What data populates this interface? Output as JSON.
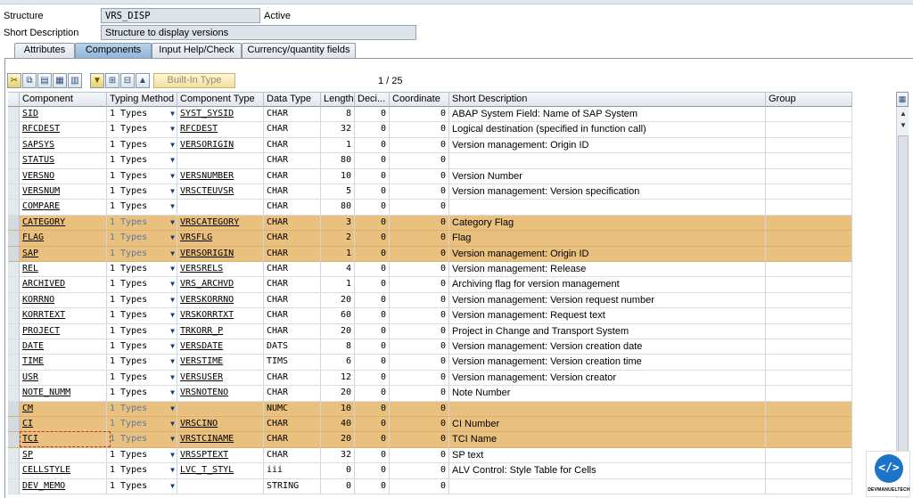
{
  "header": {
    "structure_label": "Structure",
    "structure_value": "VRS_DISP",
    "status": "Active",
    "short_desc_label": "Short Description",
    "short_desc_value": "Structure to display versions"
  },
  "tabs": [
    {
      "label": "Attributes",
      "active": false
    },
    {
      "label": "Components",
      "active": true
    },
    {
      "label": "Input Help/Check",
      "active": false
    },
    {
      "label": "Currency/quantity fields",
      "active": false
    }
  ],
  "toolbar": {
    "builtin_label": "Built-In Type",
    "pager": "1 / 25"
  },
  "columns": [
    "Component",
    "Typing Method",
    "Component Type",
    "Data Type",
    "Length",
    "Deci...",
    "Coordinate",
    "Short Description",
    "Group"
  ],
  "rows": [
    {
      "component": "SID",
      "typing": "1 Types",
      "ctype": "SYST_SYSID",
      "dtype": "CHAR",
      "length": "8",
      "dec": "0",
      "coord": "0",
      "desc": "ABAP System Field: Name of SAP System",
      "hl": false
    },
    {
      "component": "RFCDEST",
      "typing": "1 Types",
      "ctype": "RFCDEST",
      "dtype": "CHAR",
      "length": "32",
      "dec": "0",
      "coord": "0",
      "desc": "Logical destination (specified in function call)",
      "hl": false
    },
    {
      "component": "SAPSYS",
      "typing": "1 Types",
      "ctype": "VERSORIGIN",
      "dtype": "CHAR",
      "length": "1",
      "dec": "0",
      "coord": "0",
      "desc": "Version management: Origin ID",
      "hl": false
    },
    {
      "component": "STATUS",
      "typing": "1 Types",
      "ctype": "",
      "dtype": "CHAR",
      "length": "80",
      "dec": "0",
      "coord": "0",
      "desc": "",
      "hl": false
    },
    {
      "component": "VERSNO",
      "typing": "1 Types",
      "ctype": "VERSNUMBER",
      "dtype": "CHAR",
      "length": "10",
      "dec": "0",
      "coord": "0",
      "desc": "Version Number",
      "hl": false
    },
    {
      "component": "VERSNUM",
      "typing": "1 Types",
      "ctype": "VRSCTEUVSR",
      "dtype": "CHAR",
      "length": "5",
      "dec": "0",
      "coord": "0",
      "desc": "Version management: Version specification",
      "hl": false
    },
    {
      "component": "COMPARE",
      "typing": "1 Types",
      "ctype": "",
      "dtype": "CHAR",
      "length": "80",
      "dec": "0",
      "coord": "0",
      "desc": "",
      "hl": false
    },
    {
      "component": "CATEGORY",
      "typing": "1 Types",
      "ctype": "VRSCATEGORY",
      "dtype": "CHAR",
      "length": "3",
      "dec": "0",
      "coord": "0",
      "desc": "Category Flag",
      "hl": true
    },
    {
      "component": "FLAG",
      "typing": "1 Types",
      "ctype": "VRSFLG",
      "dtype": "CHAR",
      "length": "2",
      "dec": "0",
      "coord": "0",
      "desc": "Flag",
      "hl": true
    },
    {
      "component": "SAP",
      "typing": "1 Types",
      "ctype": "VERSORIGIN",
      "dtype": "CHAR",
      "length": "1",
      "dec": "0",
      "coord": "0",
      "desc": "Version management: Origin ID",
      "hl": true
    },
    {
      "component": "REL",
      "typing": "1 Types",
      "ctype": "VERSRELS",
      "dtype": "CHAR",
      "length": "4",
      "dec": "0",
      "coord": "0",
      "desc": "Version management: Release",
      "hl": false
    },
    {
      "component": "ARCHIVED",
      "typing": "1 Types",
      "ctype": "VRS_ARCHVD",
      "dtype": "CHAR",
      "length": "1",
      "dec": "0",
      "coord": "0",
      "desc": "Archiving flag for version management",
      "hl": false
    },
    {
      "component": "KORRNO",
      "typing": "1 Types",
      "ctype": "VERSKORRNO",
      "dtype": "CHAR",
      "length": "20",
      "dec": "0",
      "coord": "0",
      "desc": "Version management: Version request number",
      "hl": false
    },
    {
      "component": "KORRTEXT",
      "typing": "1 Types",
      "ctype": "VRSKORRTXT",
      "dtype": "CHAR",
      "length": "60",
      "dec": "0",
      "coord": "0",
      "desc": "Version management: Request text",
      "hl": false
    },
    {
      "component": "PROJECT",
      "typing": "1 Types",
      "ctype": "TRKORR_P",
      "dtype": "CHAR",
      "length": "20",
      "dec": "0",
      "coord": "0",
      "desc": "Project in Change and Transport System",
      "hl": false
    },
    {
      "component": "DATE",
      "typing": "1 Types",
      "ctype": "VERSDATE",
      "dtype": "DATS",
      "length": "8",
      "dec": "0",
      "coord": "0",
      "desc": "Version management: Version creation date",
      "hl": false
    },
    {
      "component": "TIME",
      "typing": "1 Types",
      "ctype": "VERSTIME",
      "dtype": "TIMS",
      "length": "6",
      "dec": "0",
      "coord": "0",
      "desc": "Version management: Version creation time",
      "hl": false
    },
    {
      "component": "USR",
      "typing": "1 Types",
      "ctype": "VERSUSER",
      "dtype": "CHAR",
      "length": "12",
      "dec": "0",
      "coord": "0",
      "desc": "Version management: Version creator",
      "hl": false
    },
    {
      "component": "NOTE_NUMM",
      "typing": "1 Types",
      "ctype": "VRSNOTENO",
      "dtype": "CHAR",
      "length": "20",
      "dec": "0",
      "coord": "0",
      "desc": "Note Number",
      "hl": false
    },
    {
      "component": "CM",
      "typing": "1 Types",
      "ctype": "",
      "dtype": "NUMC",
      "length": "10",
      "dec": "0",
      "coord": "0",
      "desc": "",
      "hl": true
    },
    {
      "component": "CI",
      "typing": "1 Types",
      "ctype": "VRSCINO",
      "dtype": "CHAR",
      "length": "40",
      "dec": "0",
      "coord": "0",
      "desc": "CI Number",
      "hl": true
    },
    {
      "component": "TCI",
      "typing": "1 Types",
      "ctype": "VRSTCINAME",
      "dtype": "CHAR",
      "length": "20",
      "dec": "0",
      "coord": "0",
      "desc": "TCI Name",
      "hl": true
    },
    {
      "component": "SP",
      "typing": "1 Types",
      "ctype": "VRSSPTEXT",
      "dtype": "CHAR",
      "length": "32",
      "dec": "0",
      "coord": "0",
      "desc": "SP text",
      "hl": false
    },
    {
      "component": "CELLSTYLE",
      "typing": "1 Types",
      "ctype": "LVC_T_STYL",
      "dtype": "iii",
      "length": "0",
      "dec": "0",
      "coord": "0",
      "desc": "ALV Control: Style Table for Cells",
      "hl": false
    },
    {
      "component": "DEV_MEMO",
      "typing": "1 Types",
      "ctype": "",
      "dtype": "STRING",
      "length": "0",
      "dec": "0",
      "coord": "0",
      "desc": "",
      "hl": false
    }
  ],
  "logo": {
    "text": "DEVMANUELTECH",
    "icon": "code-brackets-icon"
  },
  "colors": {
    "highlight": "#e9c07e",
    "active_tab": "#8fb5dc"
  }
}
